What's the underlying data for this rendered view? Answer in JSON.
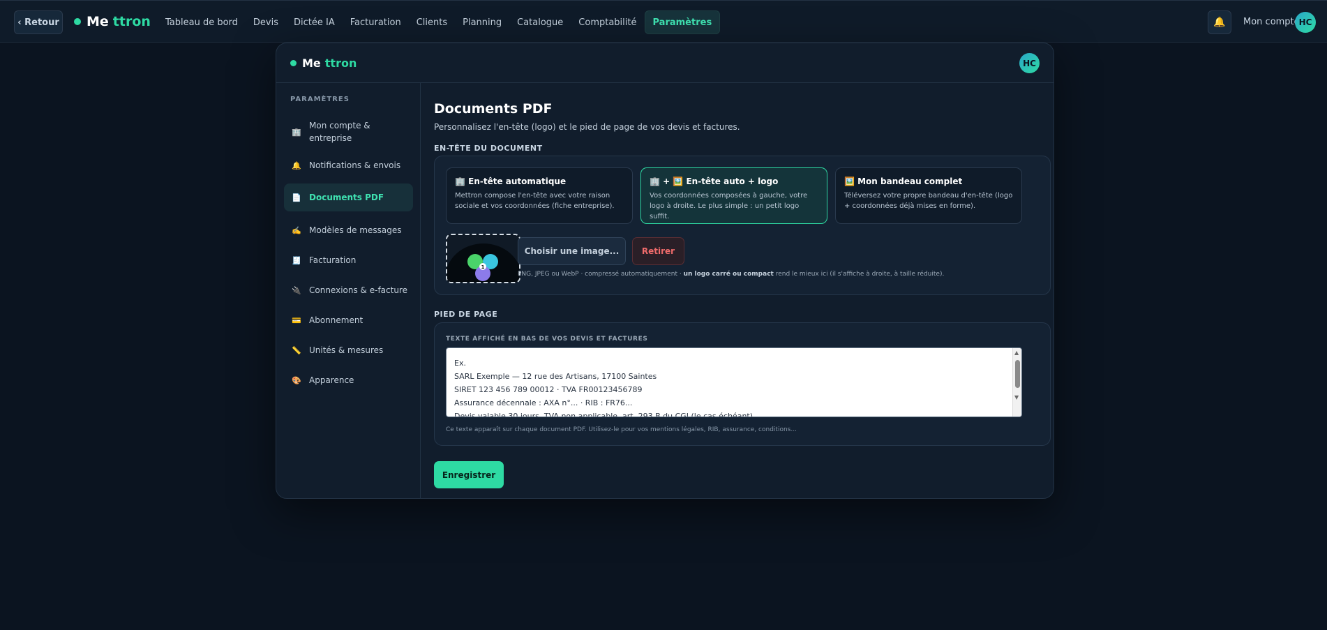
{
  "topbar": {
    "back_label": "‹ Retour",
    "brand_a": "Me",
    "brand_b": "ttron",
    "nav": [
      "Tableau de bord",
      "Devis",
      "Dictée IA",
      "Facturation",
      "Clients",
      "Planning",
      "Catalogue",
      "Comptabilité",
      "Paramètres"
    ],
    "active_nav": "Paramètres",
    "bell_icon": "🔔",
    "account_label": "Mon compte",
    "avatar_initials": "HC"
  },
  "panel": {
    "brand_a": "Me",
    "brand_b": "ttron",
    "avatar_initials": "HC"
  },
  "sidebar": {
    "title": "PARAMÈTRES",
    "items": [
      {
        "icon": "🏢",
        "label": "Mon compte & entreprise"
      },
      {
        "icon": "🔔",
        "label": "Notifications & envois"
      },
      {
        "icon": "📄",
        "label": "Documents PDF"
      },
      {
        "icon": "✍️",
        "label": "Modèles de messages"
      },
      {
        "icon": "🧾",
        "label": "Facturation"
      },
      {
        "icon": "🔌",
        "label": "Connexions & e-facture"
      },
      {
        "icon": "💳",
        "label": "Abonnement"
      },
      {
        "icon": "📏",
        "label": "Unités & mesures"
      },
      {
        "icon": "🎨",
        "label": "Apparence"
      }
    ],
    "active": "Documents PDF"
  },
  "content": {
    "title": "Documents PDF",
    "subtitle": "Personnalisez l'en-tête (logo) et le pied de page de vos devis et factures.",
    "header_section": "EN-TÊTE DU DOCUMENT",
    "options": [
      {
        "title": "🏢 En-tête automatique",
        "desc": "Mettron compose l'en-tête avec votre raison sociale et vos coordonnées (fiche entreprise)."
      },
      {
        "title": "🏢 + 🖼️ En-tête auto + logo",
        "desc": "Vos coordonnées composées à gauche, votre logo à droite. Le plus simple : un petit logo suffit."
      },
      {
        "title": "🖼️ Mon bandeau complet",
        "desc": "Téléversez votre propre bandeau d'en-tête (logo + coordonnées déjà mises en forme)."
      }
    ],
    "selected_option": 1,
    "choose_label": "Choisir une image...",
    "remove_label": "Retirer",
    "hint_pre": "PNG, JPEG ou WebP · compressé automatiquement · ",
    "hint_bold": "un logo carré ou compact",
    "hint_post": " rend le mieux ici (il s'affiche à droite, à taille réduite).",
    "logo_badge": "1",
    "footer_section": "PIED DE PAGE",
    "footer_field_label": "TEXTE AFFICHÉ EN BAS DE VOS DEVIS ET FACTURES",
    "footer_placeholder_lines": [
      "Ex.",
      "SARL Exemple — 12 rue des Artisans, 17100 Saintes",
      "SIRET 123 456 789 00012 · TVA FR00123456789",
      "Assurance décennale : AXA n°... · RIB : FR76...",
      "Devis valable 30 jours. TVA non applicable, art. 293 B du CGI (le cas échéant)."
    ],
    "footer_note": "Ce texte apparaît sur chaque document PDF. Utilisez-le pour vos mentions légales, RIB, assurance, conditions...",
    "save_label": "Enregistrer"
  }
}
